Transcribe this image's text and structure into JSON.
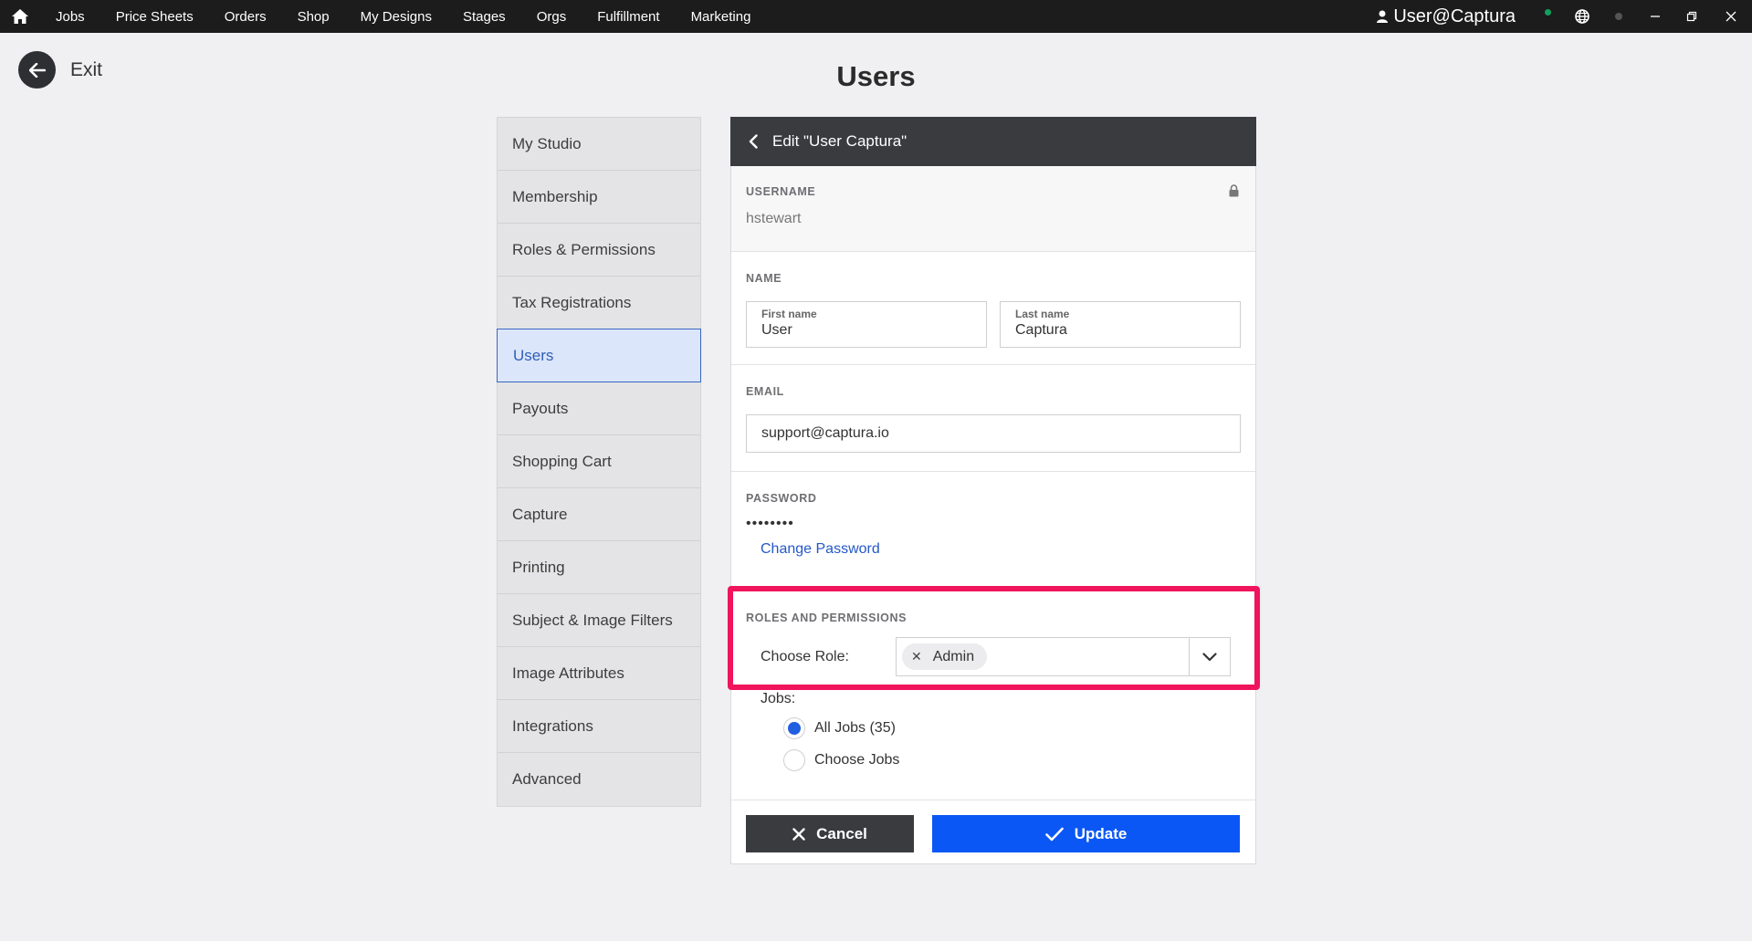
{
  "topbar": {
    "nav": [
      "Jobs",
      "Price Sheets",
      "Orders",
      "Shop",
      "My Designs",
      "Stages",
      "Orgs",
      "Fulfillment",
      "Marketing"
    ],
    "user": "User@Captura"
  },
  "exit_label": "Exit",
  "page_title": "Users",
  "sidebar": {
    "items": [
      {
        "label": "My Studio"
      },
      {
        "label": "Membership"
      },
      {
        "label": "Roles & Permissions"
      },
      {
        "label": "Tax Registrations"
      },
      {
        "label": "Users",
        "active": true
      },
      {
        "label": "Payouts"
      },
      {
        "label": "Shopping Cart"
      },
      {
        "label": "Capture"
      },
      {
        "label": "Printing"
      },
      {
        "label": "Subject & Image Filters"
      },
      {
        "label": "Image Attributes"
      },
      {
        "label": "Integrations"
      },
      {
        "label": "Advanced"
      }
    ]
  },
  "panel": {
    "title": "Edit \"User Captura\"",
    "username": {
      "label": "USERNAME",
      "value": "hstewart"
    },
    "name": {
      "label": "NAME",
      "first_label": "First name",
      "first_value": "User",
      "last_label": "Last name",
      "last_value": "Captura"
    },
    "email": {
      "label": "EMAIL",
      "value": "support@captura.io"
    },
    "password": {
      "label": "PASSWORD",
      "mask": "••••••••",
      "change_label": "Change Password"
    },
    "roles": {
      "label": "ROLES AND PERMISSIONS",
      "choose_label": "Choose Role:",
      "selected": "Admin",
      "remove_glyph": "✕"
    },
    "jobs": {
      "label": "Jobs:",
      "option_all": "All Jobs (35)",
      "option_choose": "Choose Jobs"
    },
    "cancel_label": "Cancel",
    "update_label": "Update"
  },
  "colors": {
    "highlight": "#f0145c",
    "primary": "#0b57f5",
    "dark": "#3a3b3f"
  }
}
